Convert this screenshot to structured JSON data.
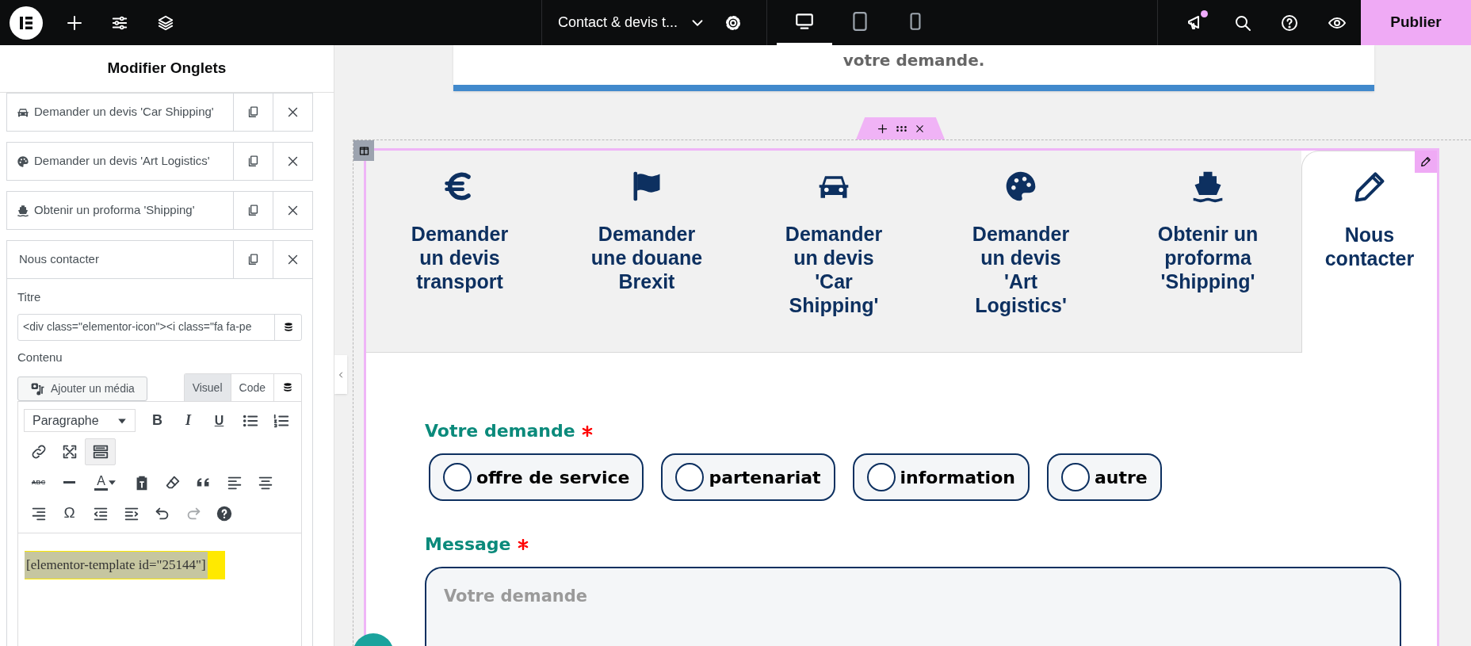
{
  "top_bar": {
    "document_title": "Contact & devis t...",
    "devices": [
      {
        "kind": "desktop",
        "selected": true
      },
      {
        "kind": "tablet",
        "selected": false
      },
      {
        "kind": "mobile",
        "selected": false
      }
    ],
    "notifications_unread": true,
    "publish_button": "Publier"
  },
  "panel": {
    "title": "Modifier Onglets",
    "items": [
      {
        "kind": "car",
        "label": "Demander un devis 'Car Shipping'",
        "expanded": false
      },
      {
        "kind": "palette",
        "label": "Demander un devis 'Art Logistics'",
        "expanded": false
      },
      {
        "kind": "ship",
        "label": "Obtenir un proforma 'Shipping'",
        "expanded": false
      },
      {
        "kind": "none",
        "label": "Nous contacter",
        "expanded": true
      }
    ],
    "editor": {
      "title_label": "Titre",
      "title_value": "<div class=\"elementor-icon\"><i class=\"fa fa-pe",
      "content_label": "Contenu",
      "media_button": "Ajouter un média",
      "modes": [
        {
          "label": "Visuel",
          "selected": true
        },
        {
          "label": "Code",
          "selected": false
        }
      ],
      "toolbar": [
        [
          {
            "kind": "select",
            "label": "Paragraphe",
            "pressed": false,
            "disabled": false
          },
          {
            "kind": "bold",
            "label": "B",
            "pressed": false,
            "disabled": false
          },
          {
            "kind": "italic",
            "label": "I",
            "pressed": false,
            "disabled": false
          },
          {
            "kind": "underline",
            "label": "U",
            "pressed": false,
            "disabled": false
          },
          {
            "kind": "bullets",
            "pressed": false,
            "disabled": false
          },
          {
            "kind": "numbers",
            "pressed": false,
            "disabled": false
          }
        ],
        [
          {
            "kind": "link",
            "pressed": false,
            "disabled": false
          },
          {
            "kind": "fullscreen",
            "pressed": false,
            "disabled": false
          },
          {
            "kind": "toolbar",
            "pressed": true,
            "disabled": false
          }
        ],
        [
          {
            "kind": "strike",
            "label": "ABC",
            "pressed": false,
            "disabled": false
          },
          {
            "kind": "rule",
            "pressed": false,
            "disabled": false
          },
          {
            "kind": "color",
            "label": "A",
            "pressed": false,
            "disabled": false
          },
          {
            "kind": "paste",
            "pressed": false,
            "disabled": false
          },
          {
            "kind": "eraser",
            "pressed": false,
            "disabled": false
          },
          {
            "kind": "quote",
            "pressed": false,
            "disabled": false
          },
          {
            "kind": "align-left",
            "pressed": false,
            "disabled": false
          },
          {
            "kind": "align-center",
            "pressed": false,
            "disabled": false
          }
        ],
        [
          {
            "kind": "align-right",
            "pressed": false,
            "disabled": false
          },
          {
            "kind": "omega",
            "label": "Ω",
            "pressed": false,
            "disabled": false
          },
          {
            "kind": "outdent",
            "pressed": false,
            "disabled": false
          },
          {
            "kind": "indent",
            "pressed": false,
            "disabled": false
          },
          {
            "kind": "undo",
            "pressed": false,
            "disabled": false
          },
          {
            "kind": "redo",
            "pressed": false,
            "disabled": true
          },
          {
            "kind": "help",
            "pressed": false,
            "disabled": false
          }
        ]
      ],
      "content": "[elementor-template id=\"25144\"]",
      "content_highlighted": true
    }
  },
  "canvas": {
    "previous_text": "votre demande.",
    "tabs": [
      {
        "kind": "euro",
        "title": "Demander un devis transport",
        "selected": false
      },
      {
        "kind": "flag",
        "title": "Demander une douane Brexit",
        "selected": false
      },
      {
        "kind": "car",
        "title": "Demander un devis 'Car Shipping'",
        "selected": false
      },
      {
        "kind": "palette",
        "title": "Demander un devis 'Art Logistics'",
        "selected": false
      },
      {
        "kind": "ship",
        "title": "Obtenir un proforma 'Shipping'",
        "selected": false
      },
      {
        "kind": "pencil",
        "title": "Nous contacter",
        "selected": true
      }
    ],
    "form": {
      "fields": [
        {
          "kind": "radio",
          "label": "Votre demande",
          "required": true,
          "options": [
            {
              "label": "offre de service",
              "checked": false
            },
            {
              "label": "partenariat",
              "checked": false
            },
            {
              "label": "information",
              "checked": false
            },
            {
              "label": "autre",
              "checked": false
            }
          ]
        },
        {
          "kind": "textarea",
          "label": "Message",
          "required": true,
          "placeholder": "Votre demande"
        }
      ]
    }
  }
}
